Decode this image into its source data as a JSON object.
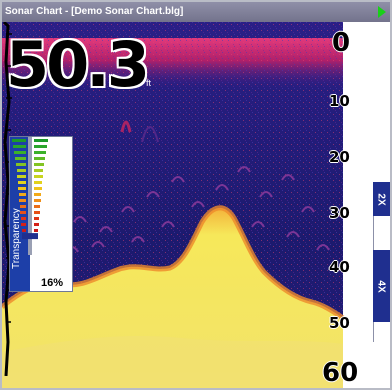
{
  "window": {
    "title": "Sonar Chart - [Demo Sonar Chart.blg]",
    "play_icon": "play-arrow-icon"
  },
  "sonar": {
    "depth_value": "50.3",
    "depth_unit": "ft",
    "scale_labels": [
      "0",
      "10",
      "20",
      "30",
      "40",
      "50",
      "60"
    ],
    "colors": {
      "water": "#1a1870",
      "surface_clutter": "#c01a62",
      "bottom": "#f4ea4e",
      "bottom_edge": "#f29a2c",
      "fish_arches": "#7b2e8c"
    }
  },
  "transparency": {
    "label": "Transparency",
    "value": "16%",
    "level_fraction": 0.16
  },
  "zoom": {
    "zoom_2x_label": "2X",
    "zoom_4x_label": "4X"
  }
}
